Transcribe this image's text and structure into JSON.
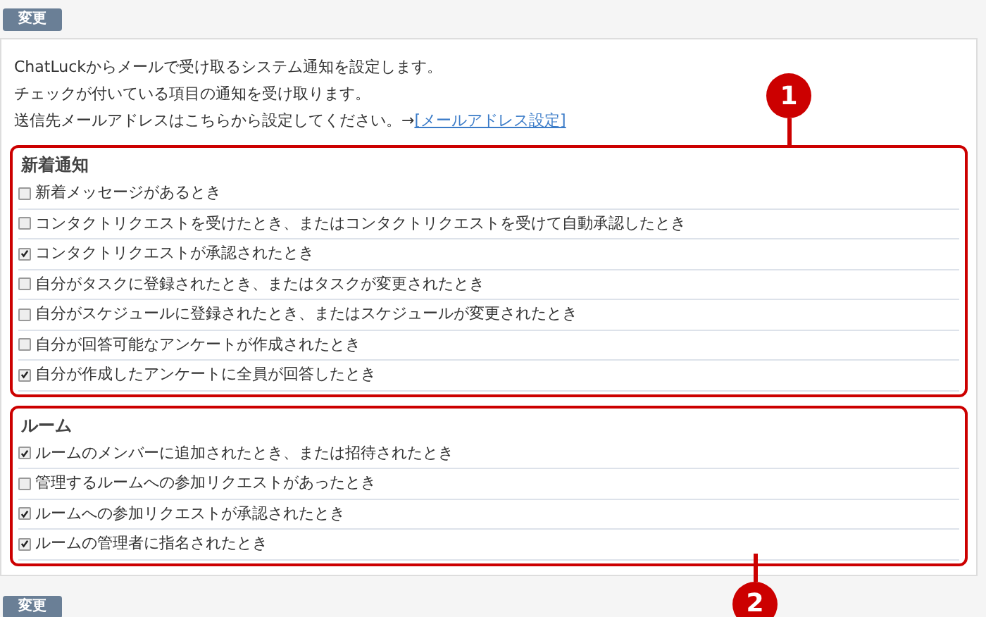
{
  "top_button": {
    "label": "変更"
  },
  "intro": [
    "ChatLuckからメールで受け取るシステム通知を設定します。",
    "チェックが付いている項目の通知を受け取ります。"
  ],
  "address_line": {
    "text": "送信先メールアドレスはこちらから設定してください。→",
    "link": "[メールアドレス設定]"
  },
  "sections": [
    {
      "title": "新着通知",
      "callout": "1",
      "items": [
        {
          "label": "新着メッセージがあるとき",
          "checked": false
        },
        {
          "label": "コンタクトリクエストを受けたとき、またはコンタクトリクエストを受けて自動承認したとき",
          "checked": false
        },
        {
          "label": "コンタクトリクエストが承認されたとき",
          "checked": true
        },
        {
          "label": "自分がタスクに登録されたとき、またはタスクが変更されたとき",
          "checked": false
        },
        {
          "label": "自分がスケジュールに登録されたとき、またはスケジュールが変更されたとき",
          "checked": false
        },
        {
          "label": "自分が回答可能なアンケートが作成されたとき",
          "checked": false
        },
        {
          "label": "自分が作成したアンケートに全員が回答したとき",
          "checked": true
        }
      ]
    },
    {
      "title": "ルーム",
      "callout": "2",
      "items": [
        {
          "label": "ルームのメンバーに追加されたとき、または招待されたとき",
          "checked": true
        },
        {
          "label": "管理するルームへの参加リクエストがあったとき",
          "checked": false
        },
        {
          "label": "ルームへの参加リクエストが承認されたとき",
          "checked": true
        },
        {
          "label": "ルームの管理者に指名されたとき",
          "checked": true
        }
      ]
    }
  ],
  "bottom_button": {
    "label": "変更"
  }
}
